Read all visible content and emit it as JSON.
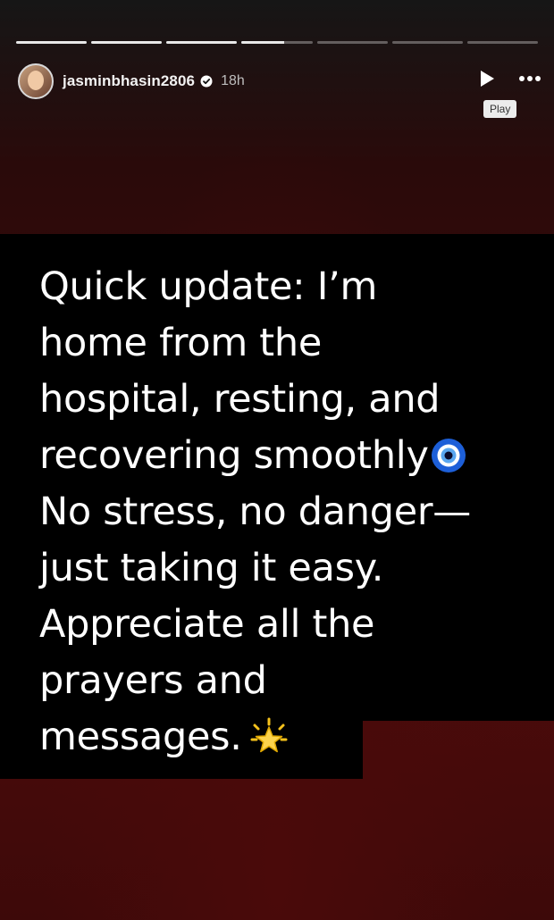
{
  "story": {
    "segments": [
      {
        "filled": 1.0
      },
      {
        "filled": 1.0
      },
      {
        "filled": 1.0
      },
      {
        "filled": 0.6
      },
      {
        "filled": 0.0
      },
      {
        "filled": 0.0
      },
      {
        "filled": 0.0
      }
    ],
    "header": {
      "username": "jasminbhasin2806",
      "time": "18h",
      "verified": true,
      "play_tooltip": "Play"
    },
    "caption_lines": [
      "Quick update: I’m",
      "home from the",
      "hospital, resting, and",
      "recovering smoothly",
      "No stress, no danger—",
      "just taking it easy.",
      "Appreciate all the",
      "prayers and",
      "messages."
    ],
    "icons": {
      "avatar": "profile-avatar",
      "verified": "verified-badge-icon",
      "play": "play-icon",
      "more": "more-options-icon",
      "eye_emoji": "nazar-amulet-emoji",
      "star_emoji": "glowing-star-emoji"
    },
    "colors": {
      "text": "#ffffff",
      "text_bg": "#000000",
      "background": "#3a0808"
    }
  }
}
